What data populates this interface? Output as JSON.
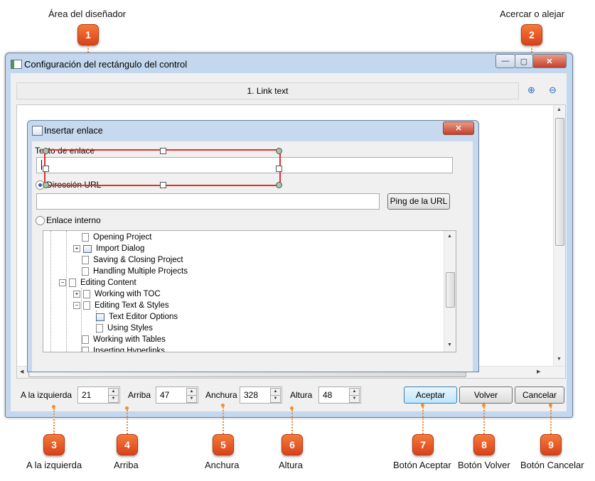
{
  "annotations": {
    "top_left": "Área del diseñador",
    "top_right": "Acercar o alejar",
    "bottom": [
      "A la izquierda",
      "Arriba",
      "Anchura",
      "Altura",
      "Botón Aceptar",
      "Botón Volver",
      "Botón Cancelar"
    ],
    "badges": [
      "1",
      "2",
      "3",
      "4",
      "5",
      "6",
      "7",
      "8",
      "9"
    ]
  },
  "window": {
    "title": "Configuración del rectángulo del control",
    "min_glyph": "—",
    "max_glyph": "▢",
    "close_glyph": "✕"
  },
  "link_bar": {
    "text": "1. Link text"
  },
  "zoom": {
    "in_icon": "zoom-in-icon",
    "out_icon": "zoom-out-icon",
    "in_glyph": "⊕",
    "out_glyph": "⊖"
  },
  "dialog": {
    "title": "Insertar enlace",
    "close_glyph": "✕",
    "link_text_label": "Texto de enlace",
    "link_text_value": "",
    "url_option": "Dirección URL",
    "url_value": "",
    "ping_button": "Ping de la URL",
    "internal_option": "Enlace interno",
    "tree": [
      {
        "label": "Opening Project",
        "icon": "page"
      },
      {
        "label": "Import Dialog",
        "icon": "window",
        "expander": "+"
      },
      {
        "label": "Saving & Closing Project",
        "icon": "page"
      },
      {
        "label": "Handling Multiple Projects",
        "icon": "page"
      },
      {
        "label": "Editing Content",
        "icon": "page",
        "expander": "−"
      },
      {
        "label": "Working with TOC",
        "icon": "page",
        "expander": "+"
      },
      {
        "label": "Editing Text & Styles",
        "icon": "page",
        "expander": "−"
      },
      {
        "label": "Text Editor Options",
        "icon": "window"
      },
      {
        "label": "Using Styles",
        "icon": "page"
      },
      {
        "label": "Working with Tables",
        "icon": "page"
      },
      {
        "label": "Inserting Hyperlinks",
        "icon": "page"
      }
    ]
  },
  "bottom": {
    "left_label": "A la izquierda",
    "left_value": "21",
    "top_label": "Arriba",
    "top_value": "47",
    "width_label": "Anchura",
    "width_value": "328",
    "height_label": "Altura",
    "height_value": "48",
    "accept": "Aceptar",
    "back": "Volver",
    "cancel": "Cancelar"
  },
  "colors": {
    "badge": "#e8571f",
    "selection": "#e23030",
    "window_frame": "#c3d7ef"
  }
}
